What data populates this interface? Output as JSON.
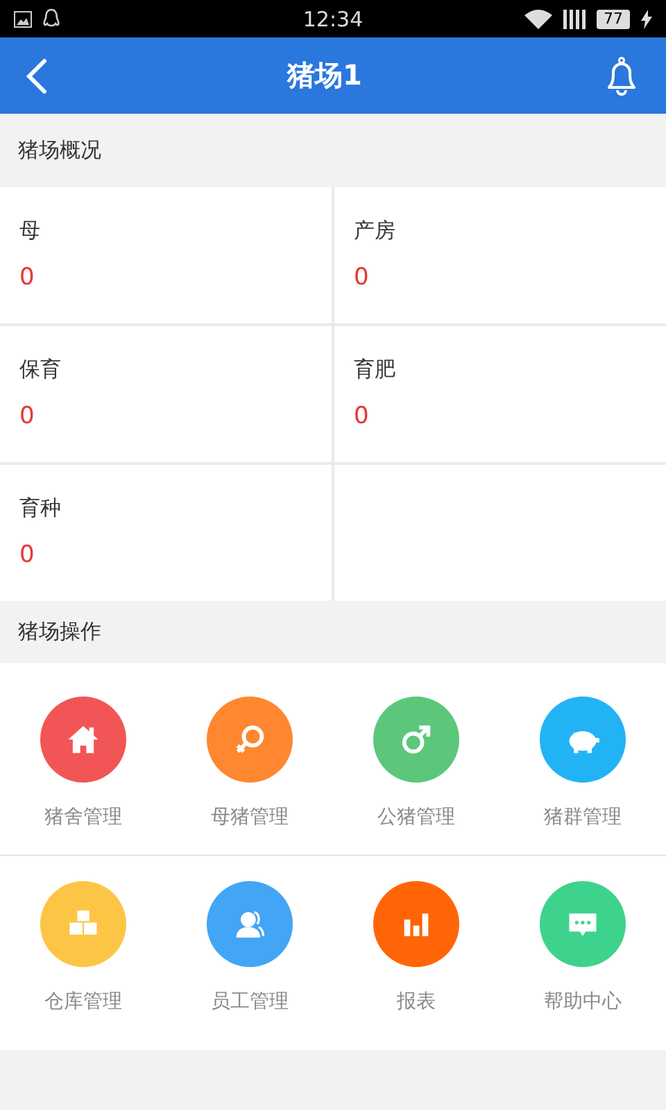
{
  "status_bar": {
    "time": "12:34",
    "battery": "77"
  },
  "header": {
    "title": "猪场1"
  },
  "overview": {
    "title": "猪场概况",
    "stats": [
      {
        "label": "母",
        "value": "0"
      },
      {
        "label": "产房",
        "value": "0"
      },
      {
        "label": "保育",
        "value": "0"
      },
      {
        "label": "育肥",
        "value": "0"
      },
      {
        "label": "育种",
        "value": "0"
      }
    ]
  },
  "operations": {
    "title": "猪场操作",
    "items": [
      {
        "label": "猪舍管理",
        "kind": "house",
        "color": "#f25555"
      },
      {
        "label": "母猪管理",
        "kind": "female",
        "color": "#fe8730"
      },
      {
        "label": "公猪管理",
        "kind": "male",
        "color": "#5cc77a"
      },
      {
        "label": "猪群管理",
        "kind": "pig",
        "color": "#22b3f5"
      },
      {
        "label": "仓库管理",
        "kind": "boxes",
        "color": "#fdc545"
      },
      {
        "label": "员工管理",
        "kind": "people",
        "color": "#42a5f5"
      },
      {
        "label": "报表",
        "kind": "chart",
        "color": "#ff6507"
      },
      {
        "label": "帮助中心",
        "kind": "chat",
        "color": "#3dd38c"
      }
    ]
  }
}
